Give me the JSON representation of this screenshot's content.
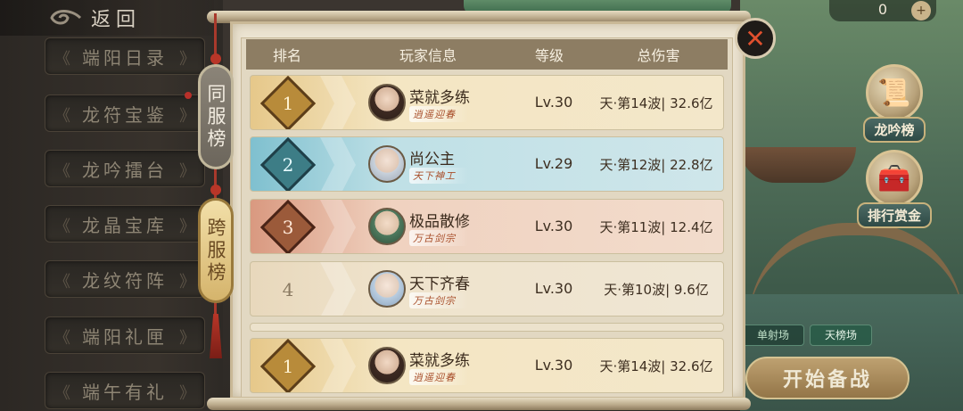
{
  "left_menu": {
    "back_label": "返回",
    "items": [
      {
        "label": "端阳日录"
      },
      {
        "label": "龙符宝鉴"
      },
      {
        "label": "龙吟擂台"
      },
      {
        "label": "龙晶宝库"
      },
      {
        "label": "龙纹符阵"
      },
      {
        "label": "端阳礼匣"
      },
      {
        "label": "端午有礼"
      }
    ]
  },
  "tabs": {
    "same_server": "同服榜",
    "cross_server": "跨服榜",
    "active": "cross_server"
  },
  "top_right": {
    "counter": "0",
    "plus_label": "+"
  },
  "side_buttons": {
    "dragon_rank": "龙吟榜",
    "rank_reward": "排行赏金"
  },
  "mode_tabs": [
    "单射场",
    "天榜场"
  ],
  "start_button": "开始备战",
  "close_glyph": "✕",
  "table": {
    "headers": {
      "rank": "排名",
      "info": "玩家信息",
      "level": "等级",
      "damage": "总伤害"
    },
    "rows": [
      {
        "rank": "1",
        "name": "菜就多练",
        "title": "逍遥迎春",
        "level": "Lv.30",
        "damage": "天·第14波| 32.6亿",
        "style": "gold"
      },
      {
        "rank": "2",
        "name": "尚公主",
        "title": "天下神工",
        "level": "Lv.29",
        "damage": "天·第12波| 22.8亿",
        "style": "blue"
      },
      {
        "rank": "3",
        "name": "极品散修",
        "title": "万古剑宗",
        "level": "Lv.30",
        "damage": "天·第11波| 12.4亿",
        "style": "bronze"
      },
      {
        "rank": "4",
        "name": "天下齐春",
        "title": "万古剑宗",
        "level": "Lv.30",
        "damage": "天·第10波| 9.6亿",
        "style": "plain"
      }
    ],
    "my_row": {
      "rank": "1",
      "name": "菜就多练",
      "title": "逍遥迎春",
      "level": "Lv.30",
      "damage": "天·第14波| 32.6亿",
      "style": "gold"
    }
  },
  "colors": {
    "gold_row": "#e6c88a",
    "blue_row": "#7fc0cf",
    "bronze_row": "#d99980",
    "header_bg": "#8d7d63",
    "close_x": "#e0502e"
  }
}
